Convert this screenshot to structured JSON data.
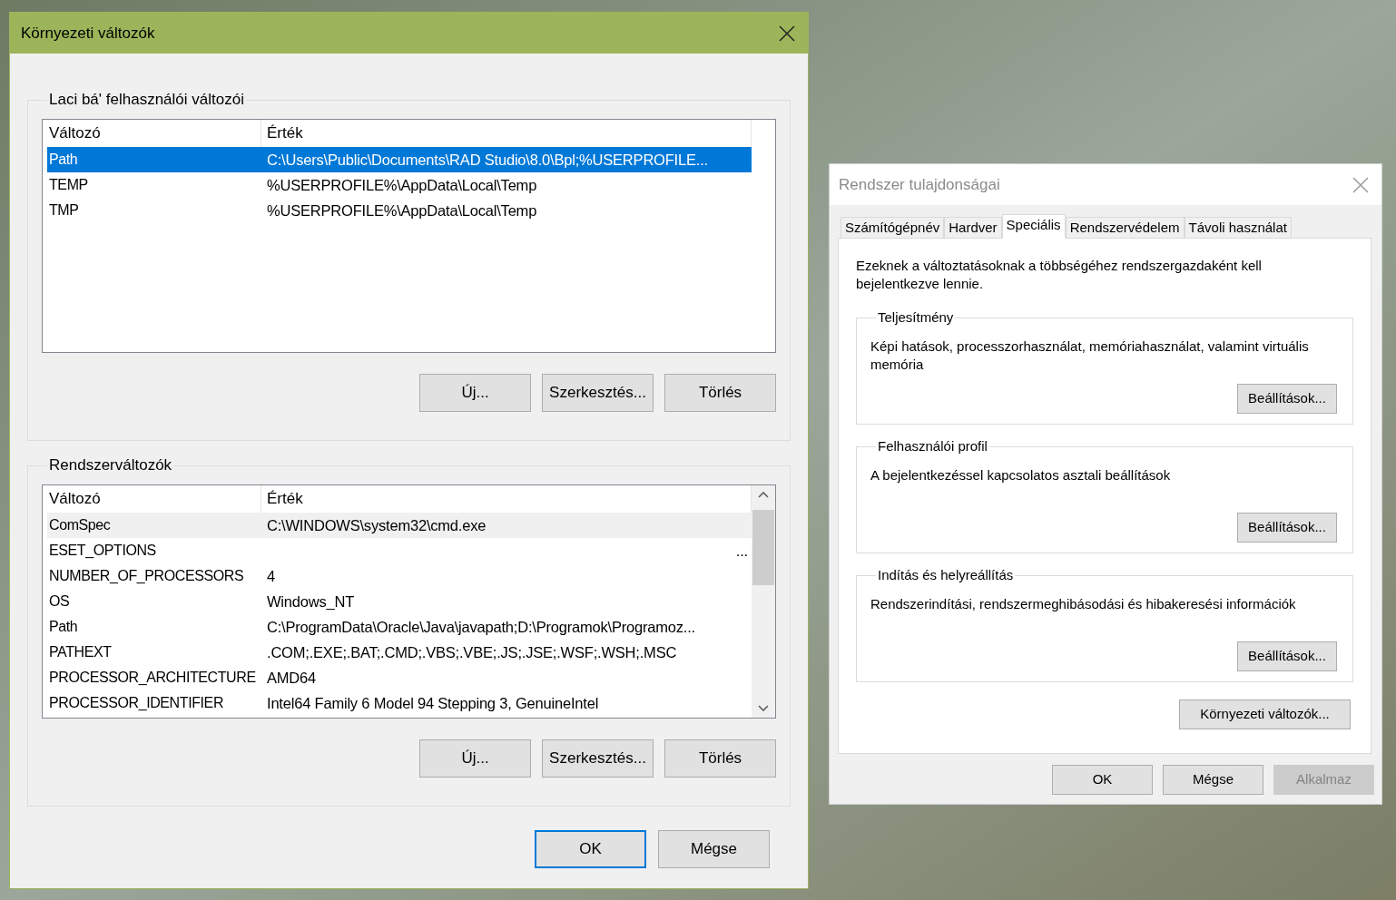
{
  "env_window": {
    "title": "Környezeti változók",
    "active": true,
    "user_group": {
      "legend": "Laci bá' felhasználói változói",
      "focused": true,
      "columns": [
        "Változó",
        "Érték"
      ],
      "rows": [
        {
          "name": "Path",
          "value": "C:\\Users\\Public\\Documents\\RAD Studio\\8.0\\Bpl;%USERPROFILE...",
          "selected": true
        },
        {
          "name": "TEMP",
          "value": "%USERPROFILE%\\AppData\\Local\\Temp",
          "selected": false
        },
        {
          "name": "TMP",
          "value": "%USERPROFILE%\\AppData\\Local\\Temp",
          "selected": false
        }
      ],
      "buttons": [
        "Új...",
        "Szerkesztés...",
        "Törlés"
      ]
    },
    "system_group": {
      "legend": "Rendszerváltozók",
      "focused": false,
      "columns": [
        "Változó",
        "Érték"
      ],
      "rows": [
        {
          "kind": "plain",
          "name": "ComSpec",
          "value": "C:\\WINDOWS\\system32\\cmd.exe",
          "selected": true
        },
        {
          "kind": "elided",
          "name": "ESET_OPTIONS",
          "value": "...",
          "selected": false
        },
        {
          "kind": "plain",
          "name": "NUMBER_OF_PROCESSORS",
          "value": "4",
          "selected": false
        },
        {
          "kind": "plain",
          "name": "OS",
          "value": "Windows_NT",
          "selected": false
        },
        {
          "kind": "plain",
          "name": "Path",
          "value": "C:\\ProgramData\\Oracle\\Java\\javapath;D:\\Programok\\Programoz...",
          "selected": false
        },
        {
          "kind": "plain",
          "name": "PATHEXT",
          "value": ".COM;.EXE;.BAT;.CMD;.VBS;.VBE;.JS;.JSE;.WSF;.WSH;.MSC",
          "selected": false
        },
        {
          "kind": "plain",
          "name": "PROCESSOR_ARCHITECTURE",
          "value": "AMD64",
          "selected": false
        },
        {
          "kind": "plain",
          "name": "PROCESSOR_IDENTIFIER",
          "value": "Intel64 Family 6 Model 94 Stepping 3, GenuineIntel",
          "selected": false
        }
      ],
      "buttons": [
        "Új...",
        "Szerkesztés...",
        "Törlés"
      ]
    },
    "buttons": [
      {
        "label": "OK",
        "default": true
      },
      {
        "label": "Mégse",
        "default": false
      }
    ]
  },
  "props_window": {
    "title": "Rendszer tulajdonságai",
    "active": false,
    "tabs": [
      {
        "label": "Számítógépnév",
        "selected": false
      },
      {
        "label": "Hardver",
        "selected": false
      },
      {
        "label": "Speciális",
        "selected": true
      },
      {
        "label": "Rendszervédelem",
        "selected": false
      },
      {
        "label": "Távoli használat",
        "selected": false
      }
    ],
    "intro": "Ezeknek a változtatásoknak a többségéhez rendszergazdaként kell bejelentkezve lennie.",
    "groups": [
      {
        "legend": "Teljesítmény",
        "description": "Képi hatások, processzorhasználat, memóriahasználat, valamint virtuális memória",
        "button": "Beállítások..."
      },
      {
        "legend": "Felhasználói profil",
        "description": "A bejelentkezéssel kapcsolatos asztali beállítások",
        "button": "Beállítások..."
      },
      {
        "legend": "Indítás és helyreállítás",
        "description": "Rendszerindítási, rendszermeghibásodási és hibakeresési információk",
        "button": "Beállítások..."
      }
    ],
    "env_button": "Környezeti változók...",
    "buttons": [
      {
        "label": "OK",
        "disabled": false
      },
      {
        "label": "Mégse",
        "disabled": false
      },
      {
        "label": "Alkalmaz",
        "disabled": true
      }
    ]
  }
}
